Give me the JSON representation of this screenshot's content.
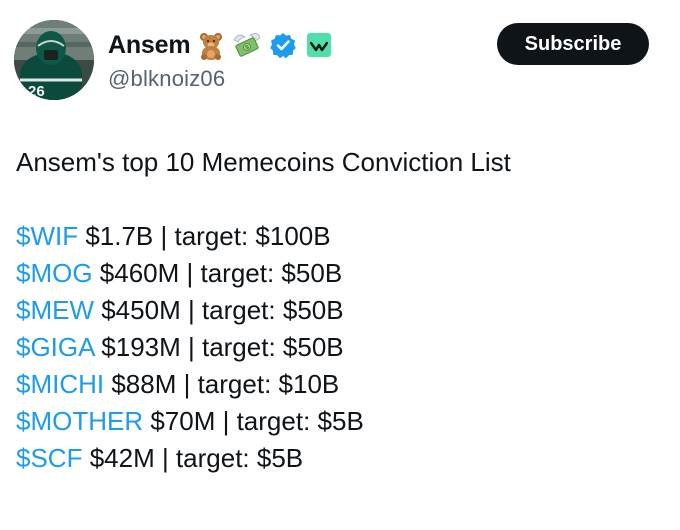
{
  "author": {
    "display_name": "Ansem",
    "handle": "@blknoiz06",
    "avatar_jersey_number": "26",
    "name_emoji": [
      "teddy-bear-emoji",
      "money-with-wings-emoji"
    ],
    "verified": true
  },
  "actions": {
    "subscribe_label": "Subscribe"
  },
  "tweet": {
    "title": "Ansem's top 10 Memecoins Conviction List",
    "coins": [
      {
        "ticker": "$WIF",
        "rest": " $1.7B | target: $100B"
      },
      {
        "ticker": "$MOG",
        "rest": " $460M | target: $50B"
      },
      {
        "ticker": "$MEW",
        "rest": " $450M | target: $50B"
      },
      {
        "ticker": "$GIGA",
        "rest": " $193M | target: $50B"
      },
      {
        "ticker": "$MICHI",
        "rest": " $88M | target: $10B"
      },
      {
        "ticker": "$MOTHER",
        "rest": " $70M | target: $5B"
      },
      {
        "ticker": "$SCF",
        "rest": " $42M | target: $5B"
      }
    ]
  },
  "colors": {
    "link": "#1d9bf0",
    "text": "#0f1419",
    "secondary": "#536471",
    "verified": "#1d9bf0",
    "subscribe_bg": "#0f1419",
    "affiliate_badge_bg": "#4ee0a8"
  }
}
